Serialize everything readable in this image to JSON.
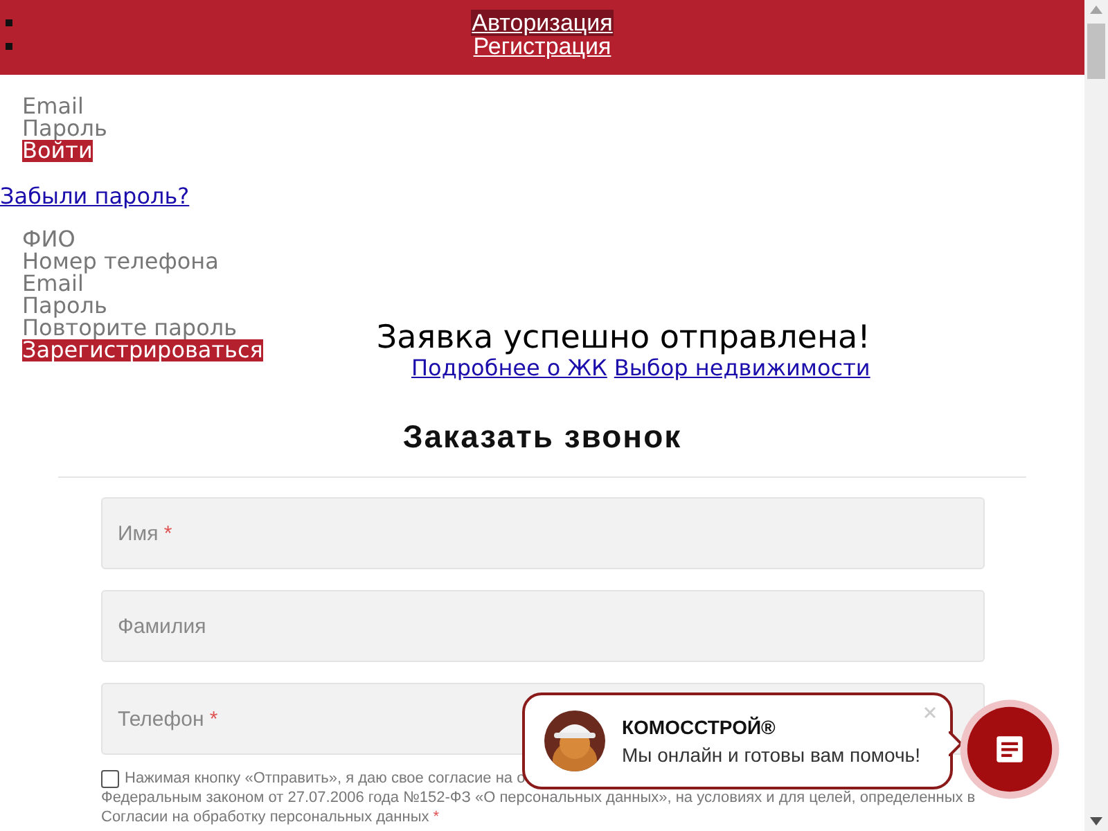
{
  "nav": [
    {
      "label": "Авторизация",
      "selected": true
    },
    {
      "label": "Регистрация",
      "selected": false
    }
  ],
  "login": {
    "fields": [
      "Email",
      "Пароль"
    ],
    "button": "Войти"
  },
  "forgot_link": "Забыли пароль?",
  "register": {
    "fields": [
      "ФИО",
      "Номер телефона",
      "Email",
      "Пароль",
      "Повторите пароль"
    ],
    "button": "Зарегистрироваться"
  },
  "success": {
    "title": "Заявка успешно отправлена!",
    "links": [
      "Подробнее о ЖК",
      "Выбор недвижимости"
    ]
  },
  "callback": {
    "title": "Заказать звонок",
    "fields": [
      {
        "placeholder": "Имя",
        "mark": "*"
      },
      {
        "placeholder": "Фамилия"
      },
      {
        "placeholder": "Телефон",
        "mark": "*"
      }
    ],
    "consent": {
      "checked": false,
      "lines": [
        "Нажимая кнопку «Отправить», я даю свое согласие на о",
        "Федеральным законом от 27.07.2006 года №152-ФЗ «О персональных данных», на условиях и для целей, определенных в",
        "Согласии на обработку персональных данных"
      ],
      "mark": "*"
    }
  },
  "chat": {
    "title": "КОМОССТРОЙ®",
    "message": "Мы онлайн и готовы вам помочь!"
  }
}
